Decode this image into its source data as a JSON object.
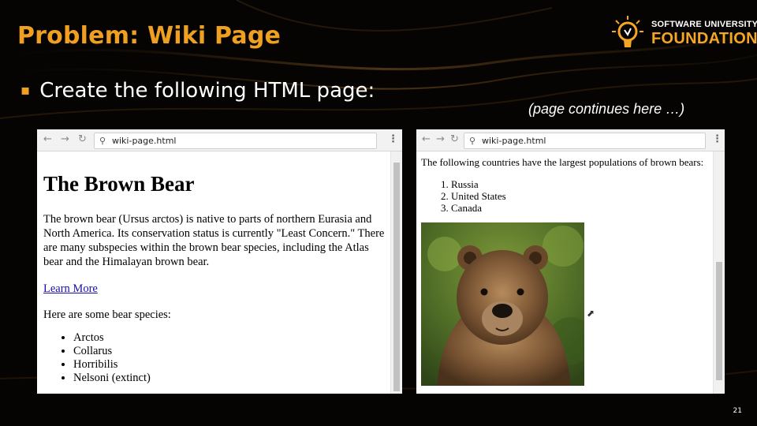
{
  "slide": {
    "title": "Problem: Wiki Page",
    "bullet": "Create the following HTML page:",
    "continue_note": "(page continues here …)",
    "page_number": "21"
  },
  "logo": {
    "line1": "SOFTWARE UNIVERSITY",
    "line2": "FOUNDATION"
  },
  "colors": {
    "title": "#f0a020",
    "background": "#050403",
    "link": "#1a0dab"
  },
  "browser_left": {
    "address": "wiki-page.html",
    "heading": "The Brown Bear",
    "paragraph": "The brown bear (Ursus arctos) is native to parts of northern Eurasia and North America. Its conservation status is currently \"Least Concern.\" There are many subspecies within the brown bear species, including the Atlas bear and the Himalayan brown bear.",
    "link": "Learn More",
    "species_intro": "Here are some bear species:",
    "species": [
      "Arctos",
      "Collarus",
      "Horribilis",
      "Nelsoni (extinct)"
    ]
  },
  "browser_right": {
    "address": "wiki-page.html",
    "countries_intro": "The following countries have the largest populations of brown bears:",
    "countries": [
      "Russia",
      "United States",
      "Canada"
    ]
  },
  "icons": [
    "back-arrow-icon",
    "forward-arrow-icon",
    "reload-icon",
    "search-icon",
    "menu-dots-icon",
    "mouse-cursor-icon",
    "lightbulb-logo-icon"
  ]
}
